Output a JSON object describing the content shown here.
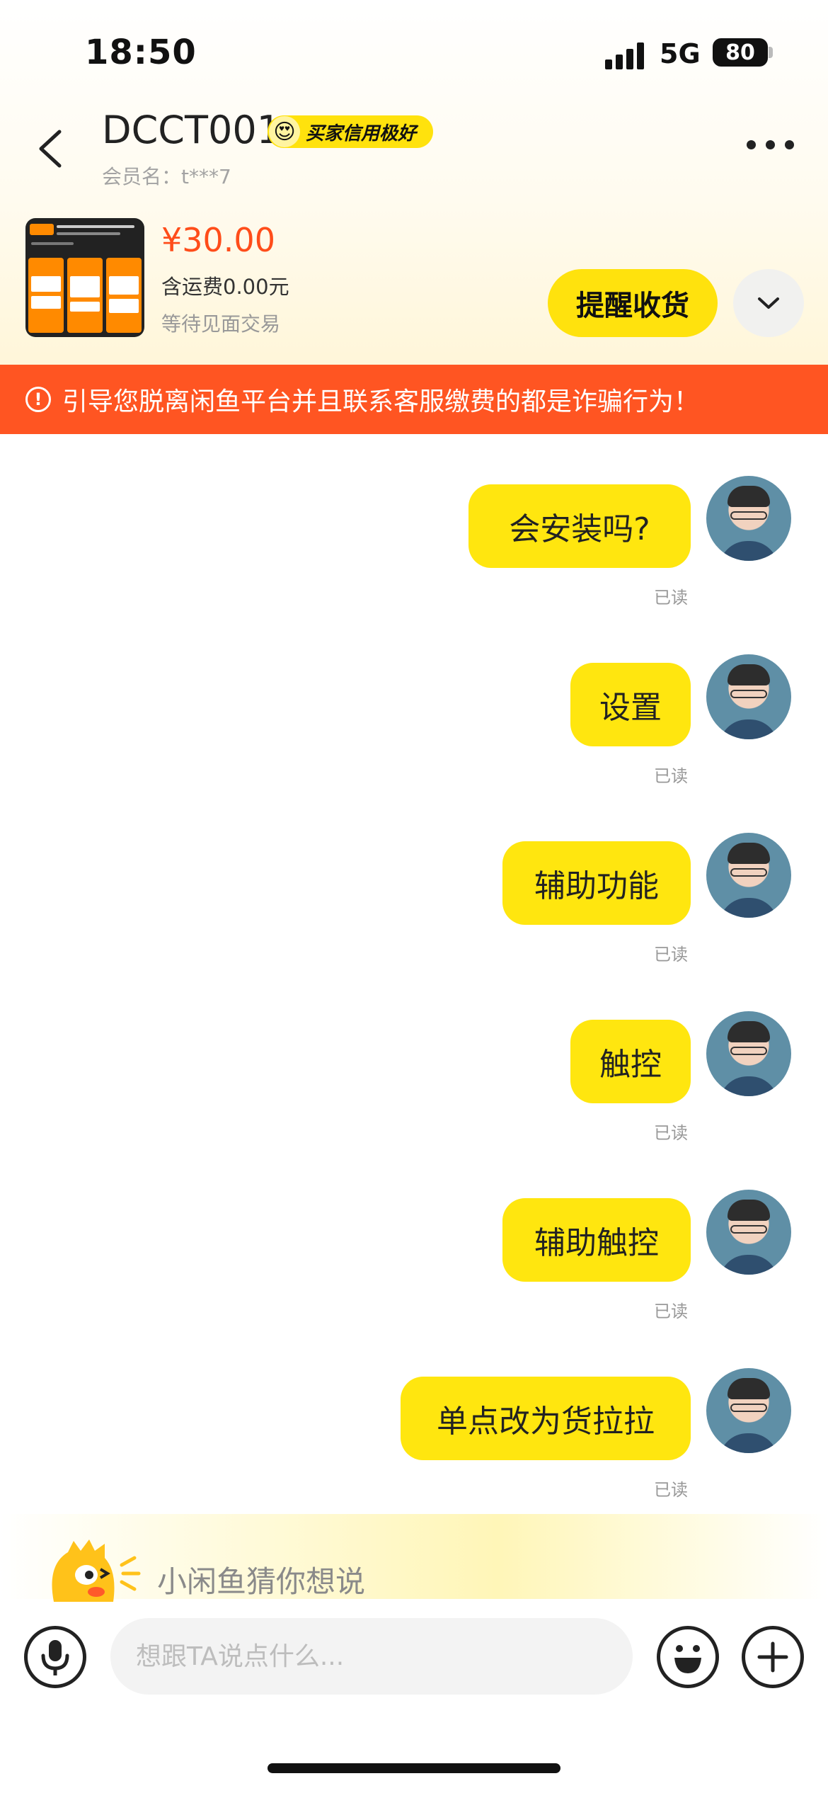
{
  "status_bar": {
    "time": "18:50",
    "network": "5G",
    "battery": "80"
  },
  "header": {
    "title": "DCCT001",
    "credit_badge": "买家信用极好",
    "member_label": "会员名：t***7"
  },
  "order": {
    "price": "¥30.00",
    "shipping": "含运费0.00元",
    "status": "等待见面交易",
    "remind_button": "提醒收货"
  },
  "warning": {
    "icon": "exclamation-circle-icon",
    "text": "引导您脱离闲鱼平台并且联系客服缴费的都是诈骗行为！"
  },
  "messages": [
    {
      "text": "会安装吗?",
      "status": "已读"
    },
    {
      "text": "设置",
      "status": "已读"
    },
    {
      "text": "辅助功能",
      "status": "已读"
    },
    {
      "text": "触控",
      "status": "已读"
    },
    {
      "text": "辅助触控",
      "status": "已读"
    },
    {
      "text": "单点改为货拉拉",
      "status": "已读"
    }
  ],
  "suggestion": {
    "text": "小闲鱼猜你想说"
  },
  "input": {
    "placeholder": "想跟TA说点什么..."
  },
  "colors": {
    "accent": "#ffe60f",
    "warning": "#ff5522",
    "price": "#ff4d1a"
  }
}
